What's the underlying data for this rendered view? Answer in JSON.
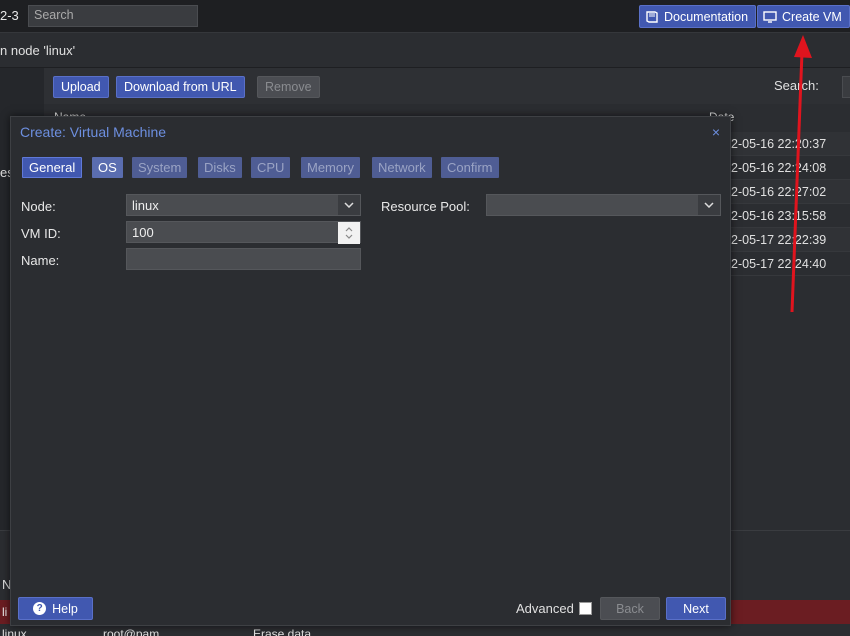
{
  "topbar": {
    "version": "2-3",
    "search_placeholder": "Search",
    "documentation_label": "Documentation",
    "create_vm_label": "Create VM"
  },
  "node_header": "n node 'linux'",
  "leftnav": {
    "partial_label": "es"
  },
  "storage_toolbar": {
    "upload_label": "Upload",
    "download_label": "Download from URL",
    "separator": "|",
    "remove_label": "Remove",
    "search_label": "Search:"
  },
  "grid": {
    "col_name": "Name",
    "col_date": "Date",
    "dates": [
      "2-05-16 22:20:37",
      "2-05-16 22:24:08",
      "2-05-16 22:27:02",
      "2-05-16 23:15:58",
      "2-05-17 22:22:39",
      "2-05-17 22:24:40"
    ]
  },
  "bottom": {
    "n_label": "N",
    "red_row_label": "li",
    "last_row": [
      "linux",
      "root@pam",
      "Erase data"
    ]
  },
  "dialog": {
    "title": "Create: Virtual Machine",
    "close": "×",
    "tabs": [
      "General",
      "OS",
      "System",
      "Disks",
      "CPU",
      "Memory",
      "Network",
      "Confirm"
    ],
    "fields": {
      "node_label": "Node:",
      "node_value": "linux",
      "vmid_label": "VM ID:",
      "vmid_value": "100",
      "name_label": "Name:",
      "pool_label": "Resource Pool:"
    },
    "footer": {
      "help_label": "Help",
      "advanced_label": "Advanced",
      "back_label": "Back",
      "next_label": "Next"
    }
  },
  "colors": {
    "accent": "#4158b0",
    "title": "#6d8fe0",
    "annotation_arrow": "#e0141e"
  }
}
